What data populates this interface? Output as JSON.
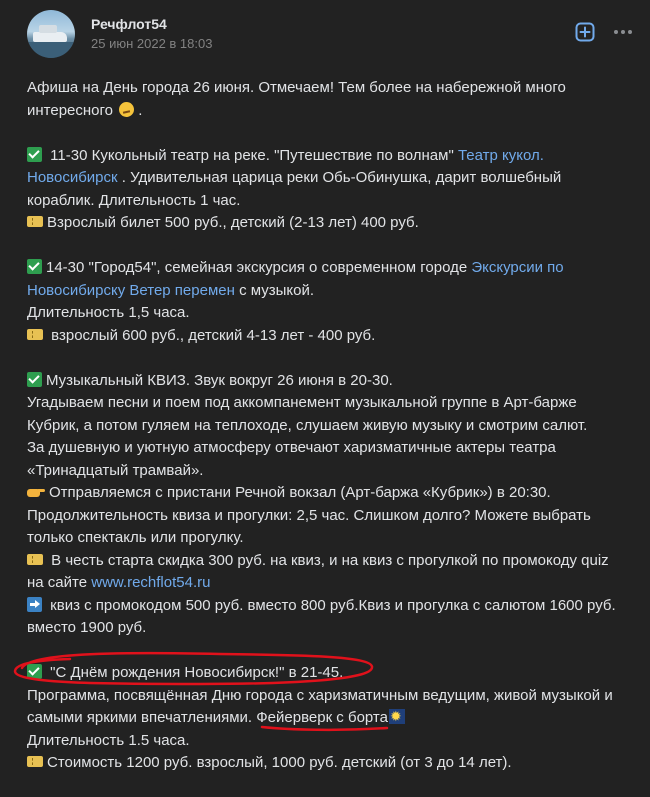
{
  "post": {
    "author": "Речфлот54",
    "date": "25 июн 2022 в 18:03",
    "avatar_icon": "river-boat-avatar",
    "actions": {
      "add_icon": "plus-square-icon",
      "more_icon": "more-horizontal-icon"
    }
  },
  "content": {
    "intro": {
      "l1": "Афиша на День города 26 июня. Отмечаем! Тем более на набережной много",
      "l2": "интересного"
    },
    "item1": {
      "l1_text": "11-30 Кукольный театр на реке. \"Путешествие по волнам\"",
      "l1_link": "Театр кукол.",
      "l2_link": "Новосибирск",
      "l2_text": ". Удивительная царица реки Обь-Обинушка, дарит волшебный",
      "l3": "кораблик. Длительность 1 час.",
      "l4": "Взрослый билет 500 руб., детский (2-13 лет) 400 руб."
    },
    "item2": {
      "l1_text": "14-30 \"Город54\", семейная экскурсия  о современном городе",
      "l1_link": "Экскурсии по",
      "l2_link": "Новосибирску Ветер перемен",
      "l2_text": "с музыкой.",
      "l3": "Длительность 1,5 часа.",
      "l4": "взрослый 600 руб., детский 4-13 лет - 400 руб."
    },
    "item3": {
      "l1": "Музыкальный КВИЗ. Звук вокруг 26 июня в 20-30.",
      "l2": "Угадываем песни и поем под аккомпанемент музыкальной группе в Арт-барже",
      "l3": "Кубрик, а потом гуляем на теплоходе, слушаем живую музыку и смотрим салют.",
      "l4": "За душевную и уютную атмосферу отвечают харизматичные актеры театра",
      "l5": "«Тринадцатый трамвай».",
      "l6": "Отправляемся с пристани Речной вокзал (Арт-баржа «Кубрик») в 20:30.",
      "l7": "Продолжительность квиза и прогулки:  2,5 час. Слишком долго? Можете выбрать",
      "l8": "только спектакль или прогулку.",
      "l9": "В честь старта скидка 300 руб. на квиз, и на квиз с прогулкой по промокоду quiz",
      "l10_text": "на сайте",
      "l10_link": "www.rechflot54.ru",
      "l11": "квиз с промокодом 500 руб. вместо 800 руб.Квиз и прогулка с салютом 1600 руб.",
      "l12": "вместо 1900 руб."
    },
    "item4": {
      "l1": "\"С Днём рождения Новосибирск!\" в 21-45.",
      "l2": "Программа, посвящённая Дню города с харизматичным ведущим, живой музыкой и",
      "l3_text": "самыми яркими впечатлениями.",
      "l3_highlight": "Фейерверк с борта",
      "l4": "Длительность 1.5 часа.",
      "l5": "Стоимость 1200 руб. взрослый, 1000 руб. детский (от 3 до 14 лет)."
    }
  },
  "annotation": {
    "color": "#e0111b"
  }
}
